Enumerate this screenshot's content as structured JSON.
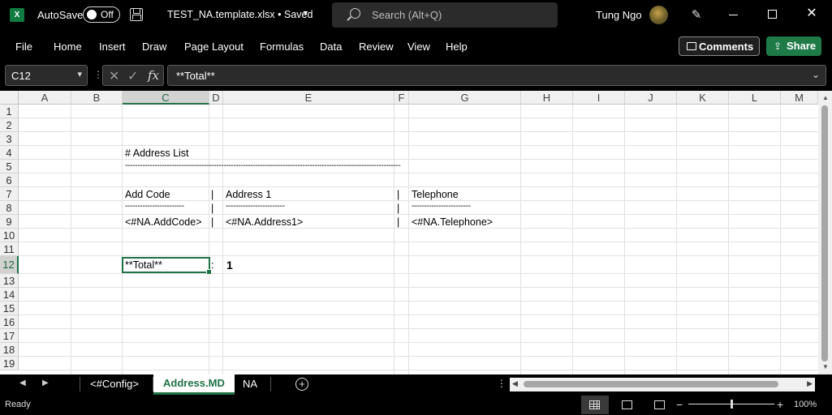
{
  "app": {
    "logo_letter": "X",
    "autosave_label": "AutoSave",
    "autosave_state": "Off",
    "doc_title": "TEST_NA.template.xlsx • Saved",
    "search_placeholder": "Search (Alt+Q)",
    "user_name": "Tung Ngo",
    "accent": "#1e7145"
  },
  "ribbon": {
    "tabs": [
      "File",
      "Home",
      "Insert",
      "Draw",
      "Page Layout",
      "Formulas",
      "Data",
      "Review",
      "View",
      "Help"
    ],
    "comments_label": "Comments",
    "share_label": "Share"
  },
  "formula_bar": {
    "name_box": "C12",
    "fx_label": "fx",
    "content": "**Total**"
  },
  "grid": {
    "columns": [
      "A",
      "B",
      "C",
      "D",
      "E",
      "F",
      "G",
      "H",
      "I",
      "J",
      "K",
      "L",
      "M"
    ],
    "selected_column": "C",
    "rows": [
      "1",
      "2",
      "3",
      "4",
      "5",
      "6",
      "7",
      "8",
      "9",
      "10",
      "11",
      "12",
      "13",
      "14",
      "15",
      "16",
      "17",
      "18",
      "19"
    ],
    "selected_row": "12",
    "cells": {
      "c4": "# Address List",
      "c5": "----------------------------------------------------------------------------------------------------------------",
      "c7": "Add Code",
      "d7": "|",
      "e7": "Address 1",
      "f7": "|",
      "g7": "Telephone",
      "c8": "------------------------",
      "d8": "|",
      "e8": "------------------------",
      "f8": "|",
      "g8": "------------------------",
      "c9": "<#NA.AddCode>",
      "d9": "|",
      "e9": "<#NA.Address1>",
      "f9": "|",
      "g9": "<#NA.Telephone>",
      "c12": "**Total**",
      "d12": ":",
      "e12": "1"
    }
  },
  "sheets": {
    "tabs": [
      "<#Config>",
      "Address.MD",
      "NA"
    ],
    "active": "Address.MD"
  },
  "status": {
    "ready": "Ready",
    "zoom": "100%"
  }
}
